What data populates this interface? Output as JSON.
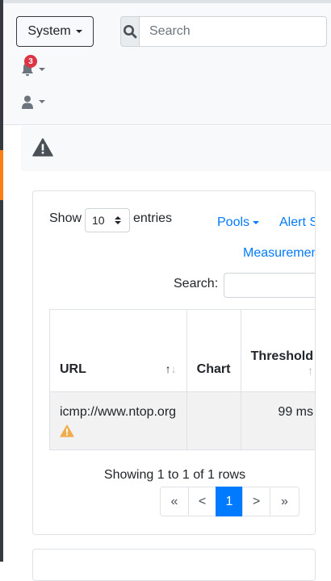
{
  "navbar": {
    "system_label": "System",
    "search_placeholder": "Search",
    "notifications_count": "3"
  },
  "table_controls": {
    "show_label": "Show",
    "page_size": "10",
    "entries_label": "entries",
    "pools_label": "Pools",
    "alert_status_label": "Alert Sta",
    "measurement_label": "Measurement",
    "search_label": "Search:"
  },
  "table": {
    "headers": {
      "url": "URL",
      "chart": "Chart",
      "threshold": "Threshold"
    },
    "rows": [
      {
        "url": "icmp://www.ntop.org",
        "chart": "",
        "threshold": "99 ms"
      }
    ]
  },
  "pagination": {
    "summary": "Showing 1 to 1 of 1 rows",
    "first": "«",
    "prev": "<",
    "current": "1",
    "next": ">",
    "last": "»"
  },
  "colors": {
    "primary": "#007bff",
    "warning": "#f0ad4e",
    "danger": "#dc3545",
    "sidebar_accent": "#fd7e14"
  },
  "icons": [
    "search-icon",
    "bell-icon",
    "user-icon",
    "warning-icon",
    "sort-icon"
  ]
}
